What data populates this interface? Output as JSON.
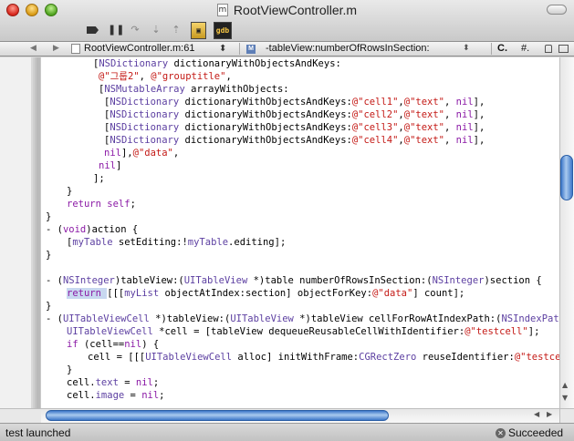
{
  "window": {
    "title": "RootViewController.m",
    "doc_icon_letter": "m"
  },
  "toolbar": {
    "breakpoints_icon": "breakpoints-icon",
    "pause_label": "❚❚",
    "continue_label": "↷",
    "step_over_label": "⇣",
    "step_into_label": "⇡",
    "activity_label": "▣",
    "gdb_label": "gdb"
  },
  "navbar": {
    "back": "◀",
    "forward": "▶",
    "file": "RootViewController.m:61",
    "file_arrows": "⬍",
    "symbol_badge": "M",
    "symbol": "-tableView:numberOfRowsInSection:",
    "symbol_arrow": "⬍",
    "c_menu": "C.",
    "hash_menu": "#."
  },
  "code": {
    "lines": [
      {
        "indent": 57,
        "text": "[NSDictionary dictionaryWithObjectsAndKeys:",
        "parts": [
          [
            "",
            "["
          ],
          [
            "cls",
            "NSDictionary"
          ],
          [
            "",
            " dictionaryWithObjectsAndKeys:"
          ]
        ]
      },
      {
        "indent": 63,
        "text": "@\"그룹2\", @\"grouptitle\",",
        "parts": [
          [
            "str",
            "@\"그룹2\""
          ],
          [
            "",
            ", "
          ],
          [
            "str",
            "@\"grouptitle\""
          ],
          [
            "",
            ","
          ]
        ]
      },
      {
        "indent": 63,
        "text": "[NSMutableArray arrayWithObjects:",
        "parts": [
          [
            "",
            "["
          ],
          [
            "cls",
            "NSMutableArray"
          ],
          [
            "",
            " arrayWithObjects:"
          ]
        ]
      },
      {
        "indent": 69,
        "text": "[NSDictionary dictionaryWithObjectsAndKeys:@\"cell1\",@\"text\", nil],",
        "parts": [
          [
            "",
            "["
          ],
          [
            "cls",
            "NSDictionary"
          ],
          [
            "",
            " dictionaryWithObjectsAndKeys:"
          ],
          [
            "str",
            "@\"cell1\""
          ],
          [
            "",
            ","
          ],
          [
            "str",
            "@\"text\""
          ],
          [
            "",
            ", "
          ],
          [
            "kw",
            "nil"
          ],
          [
            "",
            "],"
          ]
        ]
      },
      {
        "indent": 69,
        "text": "[NSDictionary dictionaryWithObjectsAndKeys:@\"cell2\",@\"text\", nil],",
        "parts": [
          [
            "",
            "["
          ],
          [
            "cls",
            "NSDictionary"
          ],
          [
            "",
            " dictionaryWithObjectsAndKeys:"
          ],
          [
            "str",
            "@\"cell2\""
          ],
          [
            "",
            ","
          ],
          [
            "str",
            "@\"text\""
          ],
          [
            "",
            ", "
          ],
          [
            "kw",
            "nil"
          ],
          [
            "",
            "],"
          ]
        ]
      },
      {
        "indent": 69,
        "text": "[NSDictionary dictionaryWithObjectsAndKeys:@\"cell3\",@\"text\", nil],",
        "parts": [
          [
            "",
            "["
          ],
          [
            "cls",
            "NSDictionary"
          ],
          [
            "",
            " dictionaryWithObjectsAndKeys:"
          ],
          [
            "str",
            "@\"cell3\""
          ],
          [
            "",
            ","
          ],
          [
            "str",
            "@\"text\""
          ],
          [
            "",
            ", "
          ],
          [
            "kw",
            "nil"
          ],
          [
            "",
            "],"
          ]
        ]
      },
      {
        "indent": 69,
        "text": "[NSDictionary dictionaryWithObjectsAndKeys:@\"cell4\",@\"text\", nil],",
        "parts": [
          [
            "",
            "["
          ],
          [
            "cls",
            "NSDictionary"
          ],
          [
            "",
            " dictionaryWithObjectsAndKeys:"
          ],
          [
            "str",
            "@\"cell4\""
          ],
          [
            "",
            ","
          ],
          [
            "str",
            "@\"text\""
          ],
          [
            "",
            ", "
          ],
          [
            "kw",
            "nil"
          ],
          [
            "",
            "],"
          ]
        ]
      },
      {
        "indent": 69,
        "text": "nil],@\"data\",",
        "parts": [
          [
            "kw",
            "nil"
          ],
          [
            "",
            "],"
          ],
          [
            "str",
            "@\"data\""
          ],
          [
            "",
            ","
          ]
        ]
      },
      {
        "indent": 63,
        "text": "nil]",
        "parts": [
          [
            "kw",
            "nil"
          ],
          [
            "",
            "]"
          ]
        ]
      },
      {
        "indent": 57,
        "text": "];",
        "parts": [
          [
            "",
            "];"
          ]
        ]
      },
      {
        "indent": 28,
        "text": "}",
        "parts": [
          [
            "",
            "}"
          ]
        ]
      },
      {
        "indent": 28,
        "text": "return self;",
        "parts": [
          [
            "kw",
            "return"
          ],
          [
            "",
            " "
          ],
          [
            "kw",
            "self"
          ],
          [
            "",
            ";"
          ]
        ]
      },
      {
        "indent": 5,
        "text": "}",
        "parts": [
          [
            "",
            "}"
          ]
        ]
      },
      {
        "indent": 5,
        "text": "- (void)action {",
        "parts": [
          [
            "",
            "- ("
          ],
          [
            "kw",
            "void"
          ],
          [
            "",
            ")action {"
          ]
        ]
      },
      {
        "indent": 28,
        "text": "[myTable setEditing:!myTable.editing];",
        "parts": [
          [
            "",
            "["
          ],
          [
            "cls",
            "myTable"
          ],
          [
            "",
            " setEditing:!"
          ],
          [
            "cls",
            "myTable"
          ],
          [
            "",
            ".editing];"
          ]
        ]
      },
      {
        "indent": 5,
        "text": "}",
        "parts": [
          [
            "",
            "}"
          ]
        ]
      },
      {
        "indent": 5,
        "text": "",
        "parts": []
      },
      {
        "indent": 5,
        "text": "- (NSInteger)tableView:(UITableView *)table numberOfRowsInSection:(NSInteger)section {",
        "parts": [
          [
            "",
            "- ("
          ],
          [
            "cls",
            "NSInteger"
          ],
          [
            "",
            ")tableView:("
          ],
          [
            "cls",
            "UITableView"
          ],
          [
            "",
            " *)table numberOfRowsInSection:("
          ],
          [
            "cls",
            "NSInteger"
          ],
          [
            "",
            ")section {"
          ]
        ]
      },
      {
        "indent": 28,
        "text": "return [[[myList objectAtIndex:section] objectForKey:@\"data\"] count];",
        "parts": [
          [
            "kw hl",
            "return"
          ],
          [
            "hl",
            " "
          ],
          [
            "",
            "[[["
          ],
          [
            "cls",
            "myList"
          ],
          [
            "",
            " objectAtIndex:section] objectForKey:"
          ],
          [
            "str",
            "@\"data\""
          ],
          [
            "",
            "] count];"
          ]
        ]
      },
      {
        "indent": 5,
        "text": "}",
        "parts": [
          [
            "",
            "}"
          ]
        ]
      },
      {
        "indent": 5,
        "text": "- (UITableViewCell *)tableView:(UITableView *)tableView cellForRowAtIndexPath:(NSIndexPath *)i",
        "parts": [
          [
            "",
            "- ("
          ],
          [
            "cls",
            "UITableViewCell"
          ],
          [
            "",
            " *)tableView:("
          ],
          [
            "cls",
            "UITableView"
          ],
          [
            "",
            " *)tableView cellForRowAtIndexPath:("
          ],
          [
            "cls",
            "NSIndexPath"
          ],
          [
            "",
            " *)i"
          ]
        ]
      },
      {
        "indent": 28,
        "text": "UITableViewCell *cell = [tableView dequeueReusableCellWithIdentifier:@\"testcell\"];",
        "parts": [
          [
            "cls",
            "UITableViewCell"
          ],
          [
            "",
            " *cell = [tableView dequeueReusableCellWithIdentifier:"
          ],
          [
            "str",
            "@\"testcell\""
          ],
          [
            "",
            "];"
          ]
        ]
      },
      {
        "indent": 28,
        "text": "if (cell==nil) {",
        "parts": [
          [
            "kw",
            "if"
          ],
          [
            "",
            " (cell=="
          ],
          [
            "kw",
            "nil"
          ],
          [
            "",
            ") {"
          ]
        ]
      },
      {
        "indent": 51,
        "text": "cell = [[[UITableViewCell alloc] initWithFrame:CGRectZero reuseIdentifier:@\"testcell\"]",
        "parts": [
          [
            "",
            "cell = [[["
          ],
          [
            "cls",
            "UITableViewCell"
          ],
          [
            "",
            " alloc] initWithFrame:"
          ],
          [
            "cls",
            "CGRectZero"
          ],
          [
            "",
            " reuseIdentifier:"
          ],
          [
            "str",
            "@\"testcell\""
          ],
          [
            "",
            "]"
          ]
        ]
      },
      {
        "indent": 28,
        "text": "}",
        "parts": [
          [
            "",
            "}"
          ]
        ]
      },
      {
        "indent": 28,
        "text": "cell.text = nil;",
        "parts": [
          [
            "",
            "cell."
          ],
          [
            "cls",
            "text"
          ],
          [
            "",
            " = "
          ],
          [
            "kw",
            "nil"
          ],
          [
            "",
            ";"
          ]
        ]
      },
      {
        "indent": 28,
        "text": "cell.image = nil;",
        "parts": [
          [
            "",
            "cell."
          ],
          [
            "cls",
            "image"
          ],
          [
            "",
            " = "
          ],
          [
            "kw",
            "nil"
          ],
          [
            "",
            ";"
          ]
        ]
      }
    ]
  },
  "scroll": {
    "vertical_up": "▲",
    "vertical_down": "▼",
    "horizontal_left": "◀",
    "horizontal_right": "▶"
  },
  "status": {
    "left": "test launched",
    "right": "Succeeded",
    "right_icon": "✕"
  },
  "colors": {
    "keyword": "#8b1aa6",
    "string": "#c41a16",
    "class": "#5c3fa1",
    "selection": "#c8d8f0",
    "scroll_thumb": "#3e78c9"
  }
}
